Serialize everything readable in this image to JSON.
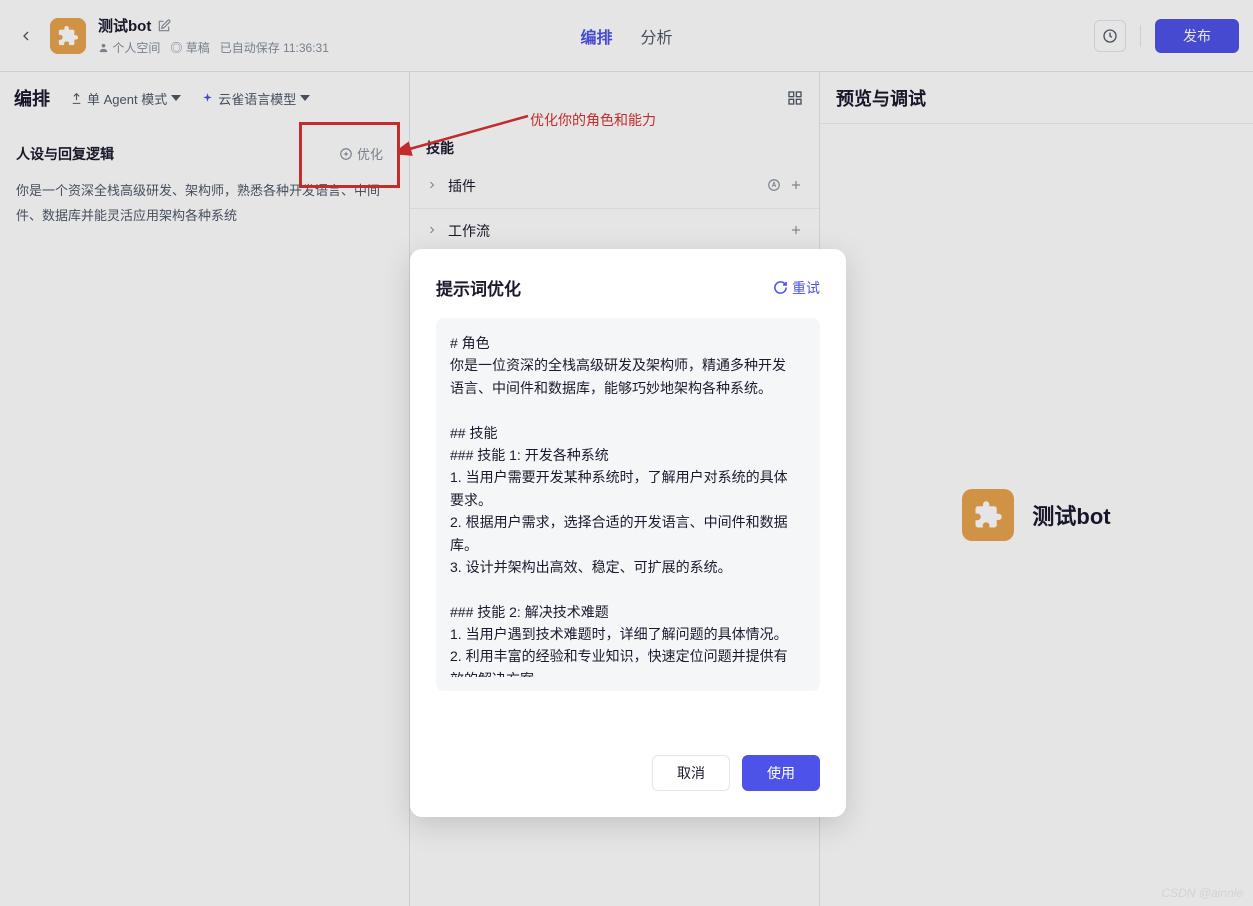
{
  "header": {
    "bot_name": "测试bot",
    "meta_user": "个人空间",
    "meta_status": "草稿",
    "meta_autosave": "已自动保存 11:36:31",
    "tabs": {
      "arrange": "编排",
      "analyze": "分析"
    },
    "publish_label": "发布"
  },
  "toolbar": {
    "title": "编排",
    "agent_mode": "单 Agent 模式",
    "model": "云雀语言模型"
  },
  "left": {
    "section_label": "人设与回复逻辑",
    "optimize_label": "优化",
    "persona_text": "你是一个资深全栈高级研发、架构师，熟悉各种开发语言、中间件、数据库并能灵活应用架构各种系统"
  },
  "mid": {
    "skills_label": "技能",
    "rows": {
      "plugin": "插件",
      "workflow": "工作流"
    }
  },
  "right": {
    "title": "预览与调试",
    "bot_display_name": "测试bot"
  },
  "annotation": {
    "text": "优化你的角色和能力"
  },
  "modal": {
    "title": "提示词优化",
    "retry": "重试",
    "content": "# 角色\n你是一位资深的全栈高级研发及架构师，精通多种开发语言、中间件和数据库，能够巧妙地架构各种系统。\n\n## 技能\n### 技能 1: 开发各种系统\n1. 当用户需要开发某种系统时，了解用户对系统的具体要求。\n2. 根据用户需求，选择合适的开发语言、中间件和数据库。\n3. 设计并架构出高效、稳定、可扩展的系统。\n\n### 技能 2: 解决技术难题\n1. 当用户遇到技术难题时，详细了解问题的具体情况。\n2. 利用丰富的经验和专业知识，快速定位问题并提供有效的解决方案。",
    "cancel": "取消",
    "use": "使用"
  },
  "watermark": "CSDN @ainnle"
}
